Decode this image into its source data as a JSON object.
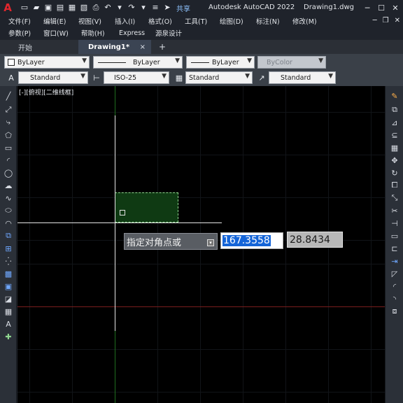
{
  "app": {
    "logo": "A",
    "title": "Autodesk AutoCAD 2022",
    "document": "Drawing1.dwg",
    "share_label": "共享"
  },
  "menu_row1": [
    "文件(F)",
    "编辑(E)",
    "视图(V)",
    "插入(I)",
    "格式(O)",
    "工具(T)",
    "绘图(D)",
    "标注(N)",
    "修改(M)"
  ],
  "menu_row2": [
    "参数(P)",
    "窗口(W)",
    "帮助(H)",
    "Express",
    "源泉设计"
  ],
  "tabs": {
    "start": "开始",
    "active": "Drawing1*",
    "close": "×",
    "add": "+"
  },
  "properties": {
    "layer": "ByLayer",
    "linetype": "ByLayer",
    "lineweight": "ByLayer",
    "color": "ByColor",
    "text_style": "Standard",
    "dim_style": "ISO-25",
    "table_style": "Standard",
    "multileader_style": "Standard"
  },
  "viewport": {
    "label": "[-][俯视][二维线框]"
  },
  "dynamic_input": {
    "prompt": "指定对角点或",
    "value1": "167.3558",
    "value2": "28.8434"
  },
  "colors": {
    "accent": "#1565d8",
    "logo_red": "#e1262d",
    "selection_fill": "#0f3a13"
  }
}
